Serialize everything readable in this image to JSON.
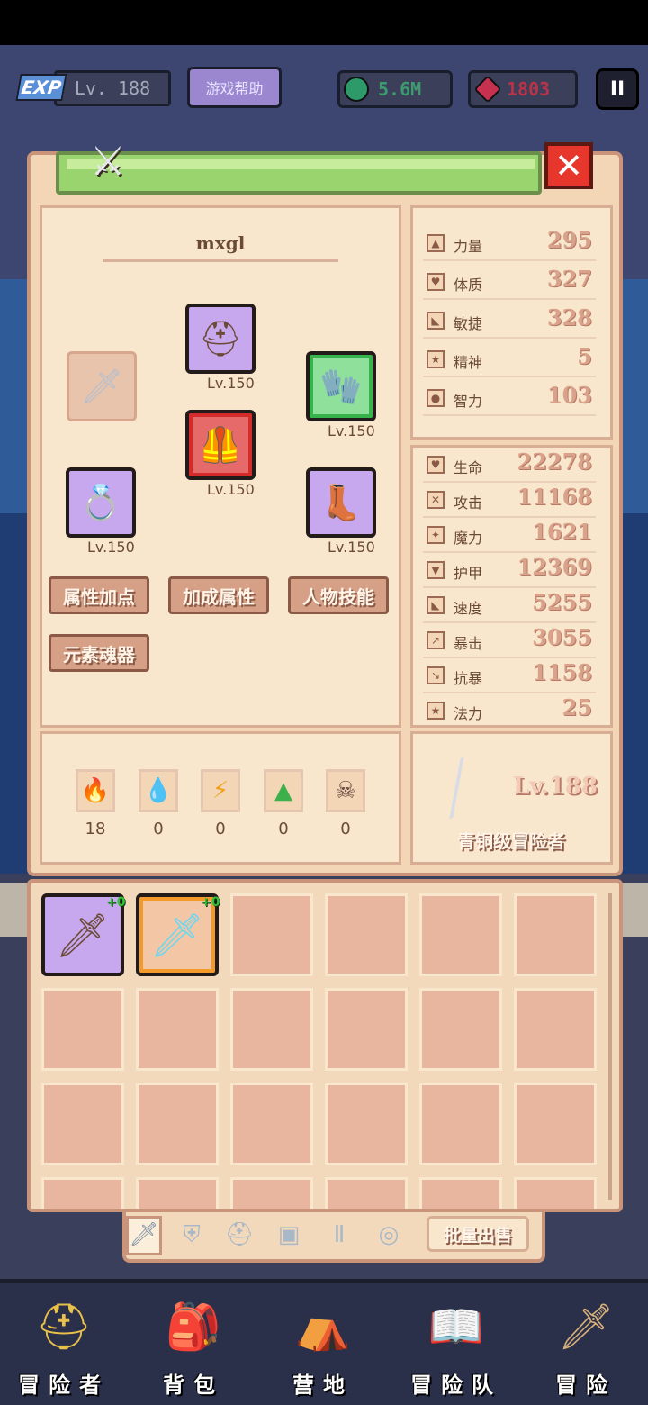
{
  "hud": {
    "exp_tag": "EXP",
    "level": "Lv. 188",
    "help_label": "游戏帮助",
    "gem_green_value": "5.6M",
    "gem_red_value": "1803",
    "pause_label": "II"
  },
  "character": {
    "name": "mxgl",
    "slots": {
      "helmet_lv": "Lv.150",
      "armor_lv": "Lv.150",
      "gloves_lv": "Lv.150",
      "ring_lv": "Lv.150",
      "boots_lv": "Lv.150"
    },
    "buttons": [
      "属性加点",
      "加成属性",
      "人物技能",
      "元素魂器"
    ]
  },
  "base_stats": [
    {
      "label": "力量",
      "value": "295",
      "icon": "strength-icon"
    },
    {
      "label": "体质",
      "value": "327",
      "icon": "constitution-icon"
    },
    {
      "label": "敏捷",
      "value": "328",
      "icon": "agility-icon"
    },
    {
      "label": "精神",
      "value": "5",
      "icon": "spirit-icon"
    },
    {
      "label": "智力",
      "value": "103",
      "icon": "intelligence-icon"
    }
  ],
  "combat_stats": [
    {
      "label": "生命",
      "value": "22278",
      "icon": "health-icon"
    },
    {
      "label": "攻击",
      "value": "11168",
      "icon": "attack-icon"
    },
    {
      "label": "魔力",
      "value": "1621",
      "icon": "magic-icon"
    },
    {
      "label": "护甲",
      "value": "12369",
      "icon": "armor-icon"
    },
    {
      "label": "速度",
      "value": "5255",
      "icon": "speed-icon"
    },
    {
      "label": "暴击",
      "value": "3055",
      "icon": "crit-icon"
    },
    {
      "label": "抗暴",
      "value": "1158",
      "icon": "crit-resist-icon"
    },
    {
      "label": "法力",
      "value": "25",
      "icon": "mana-icon"
    }
  ],
  "elements": [
    {
      "icon": "fire-element-icon",
      "value": "18"
    },
    {
      "icon": "water-element-icon",
      "value": "0"
    },
    {
      "icon": "lightning-element-icon",
      "value": "0"
    },
    {
      "icon": "earth-element-icon",
      "value": "0"
    },
    {
      "icon": "dark-element-icon",
      "value": "0"
    }
  ],
  "rank": {
    "level": "Lv.188",
    "title": "青铜级冒险者"
  },
  "inventory": {
    "items": [
      {
        "name": "purple-sword",
        "plus": "+0"
      },
      {
        "name": "ice-sword",
        "plus": "+0"
      }
    ]
  },
  "tabs": {
    "bulk_sell": "批量出售"
  },
  "nav": [
    "冒险者",
    "背包",
    "营地",
    "冒险队",
    "冒险"
  ],
  "colors": {
    "panel_bg": "#f2d6b6",
    "title_green": "#99d46e",
    "close_red": "#e7362b",
    "stat_value": "#d9a28a",
    "rare_purple": "#c7a8ee"
  }
}
